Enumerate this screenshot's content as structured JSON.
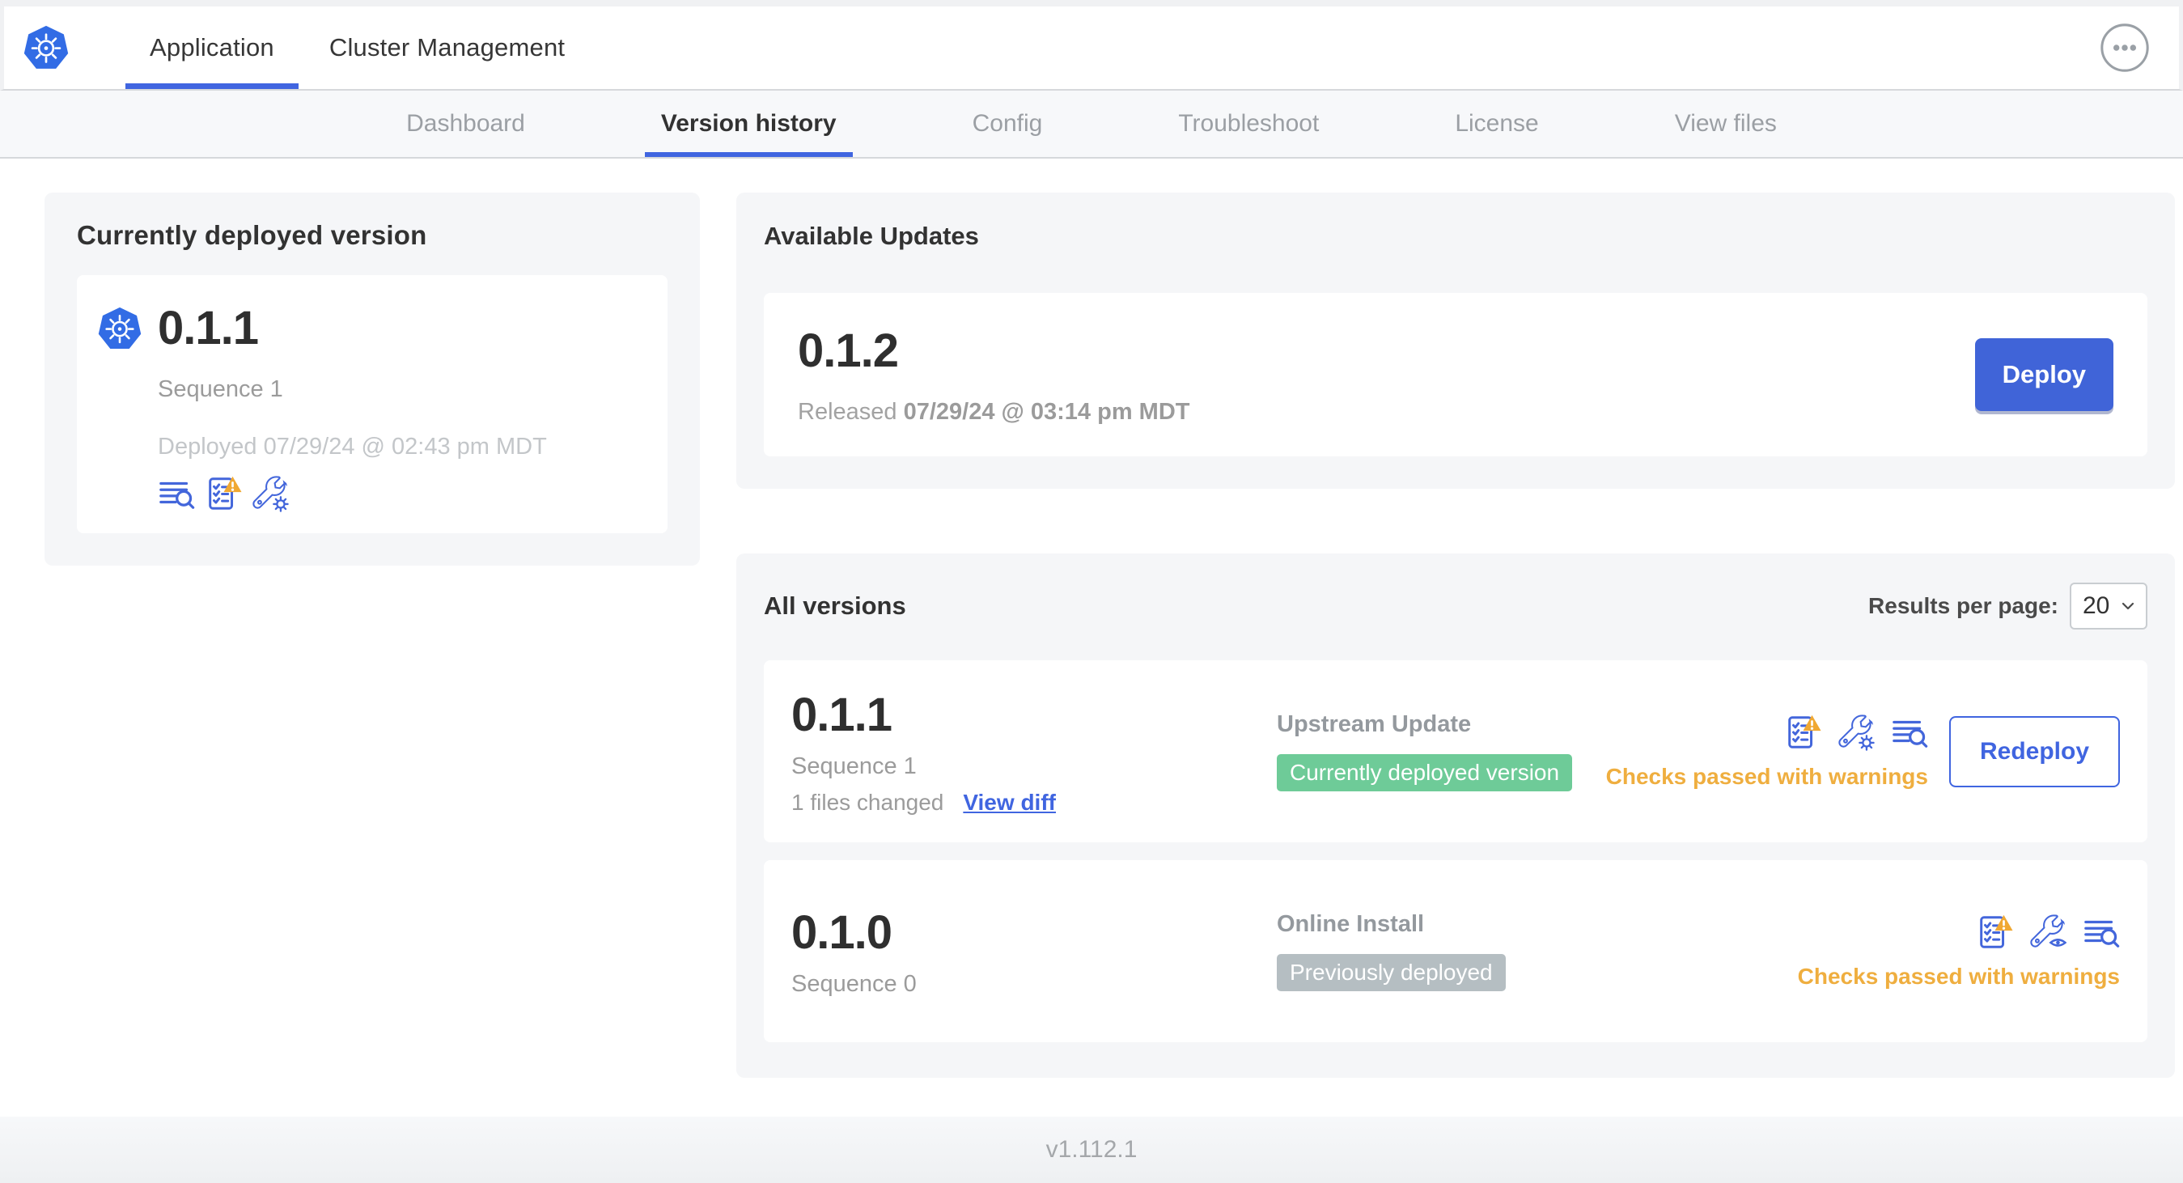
{
  "header": {
    "tabs": [
      {
        "label": "Application",
        "active": true
      },
      {
        "label": "Cluster Management",
        "active": false
      }
    ]
  },
  "subnav": {
    "tabs": [
      {
        "label": "Dashboard"
      },
      {
        "label": "Version history"
      },
      {
        "label": "Config"
      },
      {
        "label": "Troubleshoot"
      },
      {
        "label": "License"
      },
      {
        "label": "View files"
      }
    ],
    "active": "Version history"
  },
  "current_version": {
    "title": "Currently deployed version",
    "version": "0.1.1",
    "sequence": "Sequence 1",
    "deployed_at": "Deployed 07/29/24 @ 02:43 pm MDT"
  },
  "available_updates": {
    "title": "Available Updates",
    "version": "0.1.2",
    "released_prefix": "Released",
    "released_date": "07/29/24 @ 03:14 pm MDT",
    "deploy_label": "Deploy"
  },
  "all_versions": {
    "title": "All versions",
    "results_per_page_label": "Results per page:",
    "results_per_page_value": "20",
    "rows": [
      {
        "version": "0.1.1",
        "sequence": "Sequence 1",
        "files_changed": "1 files changed",
        "view_diff_label": "View diff",
        "source": "Upstream Update",
        "badge": "Currently deployed version",
        "status": "Checks passed with warnings",
        "action_label": "Redeploy"
      },
      {
        "version": "0.1.0",
        "sequence": "Sequence 0",
        "source": "Online Install",
        "badge": "Previously deployed",
        "status": "Checks passed with warnings"
      }
    ]
  },
  "footer": {
    "version": "v1.112.1"
  },
  "icons": {
    "logo": "kubernetes-helm-wheel",
    "menu": "ellipsis-in-circle",
    "release_notes": "text-lines-magnifier",
    "preflight": "checklist-with-warning-triangle",
    "edit_config": "wrench-with-gear",
    "view_config": "wrench-with-eye",
    "dropdown": "chevron-down"
  },
  "colors": {
    "accent_blue": "#4065E0",
    "kubernetes_blue": "#326CE5",
    "deploy_button_blue": "#4064D8",
    "badge_green": "#6ECB98",
    "badge_gray": "#B5BEC2",
    "warning_orange": "#EFAE3F",
    "warning_triangle": "#F0A832",
    "text_dark": "#323232",
    "text_gray": "#9B9B9B",
    "text_light_gray": "#C3C6C9",
    "card_bg": "#F5F6F8",
    "subnav_bg": "#F7F8FA"
  }
}
